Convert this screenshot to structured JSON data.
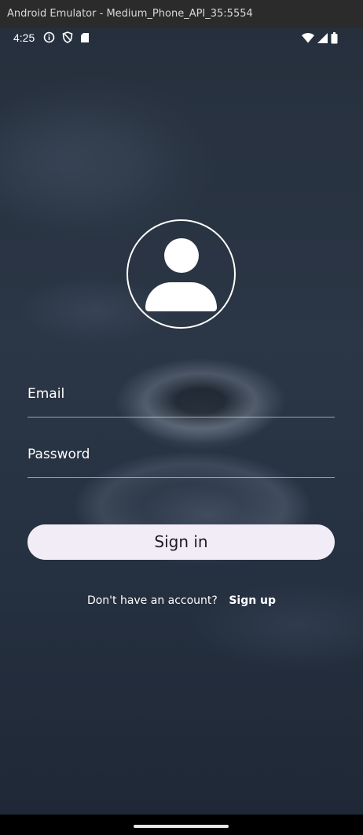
{
  "window": {
    "title": "Android Emulator - Medium_Phone_API_35:5554"
  },
  "status_bar": {
    "time": "4:25",
    "icons_left": [
      "info-icon",
      "shield-icon",
      "sd-card-icon"
    ],
    "icons_right": [
      "wifi-icon",
      "signal-icon",
      "battery-icon"
    ]
  },
  "login": {
    "avatar_icon": "person-icon",
    "email_label": "Email",
    "password_label": "Password",
    "signin_label": "Sign in",
    "signup_prompt": "Don't have an account?",
    "signup_link": "Sign up"
  },
  "colors": {
    "button_bg": "#f1ecf6",
    "button_text": "#1d1b20",
    "text": "#ffffff",
    "overlay": "#2b3646"
  }
}
